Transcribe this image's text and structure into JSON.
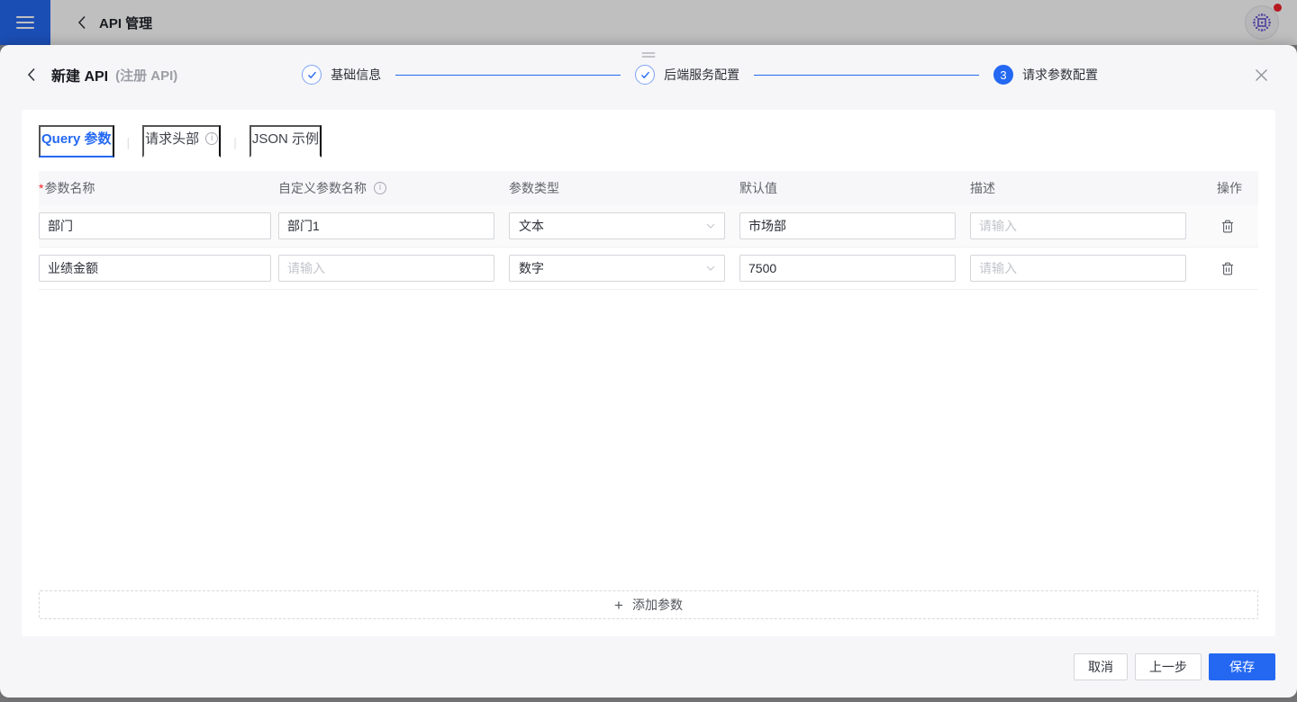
{
  "topbar": {
    "title": "API 管理"
  },
  "modal": {
    "title": "新建 API",
    "subtitle": "(注册 API)",
    "steps": [
      {
        "label": "基础信息",
        "status": "done"
      },
      {
        "label": "后端服务配置",
        "status": "done"
      },
      {
        "label": "请求参数配置",
        "status": "current",
        "number": "3"
      }
    ],
    "tabs_separator": "|",
    "tabs": [
      {
        "label": "Query 参数",
        "active": true
      },
      {
        "label": "请求头部",
        "active": false,
        "info": true
      },
      {
        "label": "JSON 示例",
        "active": false
      }
    ],
    "table": {
      "required_mark": "*",
      "headers": [
        "参数名称",
        "自定义参数名称",
        "参数类型",
        "默认值",
        "描述",
        "操作"
      ],
      "rows": [
        {
          "name": "部门",
          "custom_name": "部门1",
          "type": "文本",
          "default_value": "市场部",
          "description_placeholder": "请输入"
        },
        {
          "name": "业绩金额",
          "custom_name_placeholder": "请输入",
          "type": "数字",
          "default_value": "7500",
          "description_placeholder": "请输入"
        }
      ],
      "add_button_label": "添加参数"
    },
    "footer": {
      "cancel_label": "取消",
      "prev_label": "上一步",
      "save_label": "保存"
    }
  },
  "icons": {
    "info_glyph": "i",
    "plus_glyph": "+"
  },
  "colors": {
    "accent": "#2468f2",
    "danger": "#f5222d",
    "avatar_purple": "#6e5ad4"
  }
}
